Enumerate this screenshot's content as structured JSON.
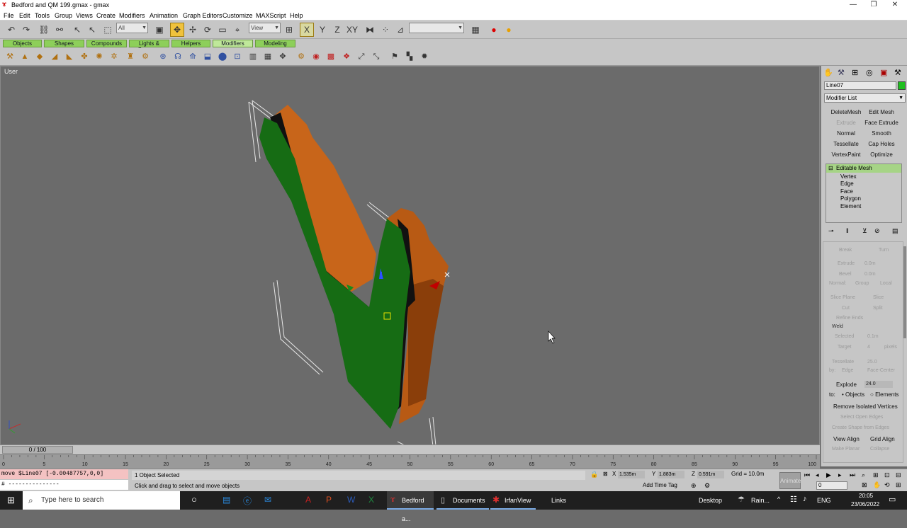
{
  "window": {
    "title": "Bedford and QM 199.gmax - gmax"
  },
  "menubar": [
    "File",
    "Edit",
    "Tools",
    "Group",
    "Views",
    "Create",
    "Modifiers",
    "Animation",
    "Graph Editors",
    "Customize",
    "MAXScript",
    "Help"
  ],
  "toolbar": {
    "selection_filter": "All",
    "ref_coord": "View"
  },
  "tabs": [
    "Objects",
    "Shapes",
    "Compounds",
    "Lights & Cameras",
    "Helpers",
    "Modifiers",
    "Modeling"
  ],
  "active_tab": "Modifiers",
  "viewport": {
    "label": "User"
  },
  "panel": {
    "object_name": "Line07",
    "object_color": "#1fbf1f",
    "modifier_list": "Modifier List",
    "buttons": [
      "DeleteMesh",
      "Edit Mesh",
      "Extrude",
      "Face Extrude",
      "Normal",
      "Smooth",
      "Tessellate",
      "Cap Holes",
      "VertexPaint",
      "Optimize"
    ],
    "stack": {
      "top": "Editable Mesh",
      "subs": [
        "Vertex",
        "Edge",
        "Face",
        "Polygon",
        "Element"
      ]
    },
    "rollout": {
      "break": "Break",
      "turn": "Turn",
      "extrude": "Extrude",
      "extrude_val": "0.0m",
      "bevel": "Bevel",
      "bevel_val": "0.0m",
      "normal": "Normal:",
      "group": "Group",
      "local": "Local",
      "slice_plane": "Slice Plane",
      "slice": "Slice",
      "cut": "Cut",
      "split": "Split",
      "refine_ends": "Refine Ends",
      "weld": "Weld",
      "selected": "Selected",
      "selected_val": "0.1m",
      "target": "Target",
      "target_val": "4",
      "pixels": "pixels",
      "tessellate": "Tessellate",
      "tess_val": "25.0",
      "by": "by:",
      "edge": "Edge",
      "face_center": "Face-Center",
      "explode": "Explode",
      "explode_val": "24.0",
      "to": "to:",
      "objects": "Objects",
      "elements": "Elements",
      "remove_isolated": "Remove Isolated Vertices",
      "select_open_edges": "Select Open Edges",
      "create_shape": "Create Shape from Edges",
      "view_align": "View Align",
      "grid_align": "Grid Align",
      "make_planar": "Make Planar",
      "collapse": "Collapse"
    }
  },
  "timeline": {
    "frame": "0 / 100",
    "ticks": [
      "0",
      "5",
      "10",
      "15",
      "20",
      "25",
      "30",
      "35",
      "40",
      "45",
      "50",
      "55",
      "60",
      "65",
      "70",
      "75",
      "80",
      "85",
      "90",
      "95",
      "100"
    ]
  },
  "status": {
    "maxscript_line": "move $Line07 [-0.00487757,0,0]",
    "maxscript_input": "# ---------------",
    "selected": "1 Object Selected",
    "prompt": "Click and drag to select and move objects",
    "x": "1.535m",
    "y": "1.883m",
    "z": "0.591m",
    "grid": "Grid = 10.0m",
    "add_time_tag": "Add Time Tag",
    "animate": "Animate",
    "frame_field": "0"
  },
  "taskbar": {
    "search": "Type here to search",
    "apps": [
      "Bedford a...",
      "Documents",
      "IrfanView",
      "Links"
    ],
    "desktop": "Desktop",
    "weather": "Rain...",
    "lang": "ENG",
    "time": "20:05",
    "date": "23/06/2022"
  }
}
